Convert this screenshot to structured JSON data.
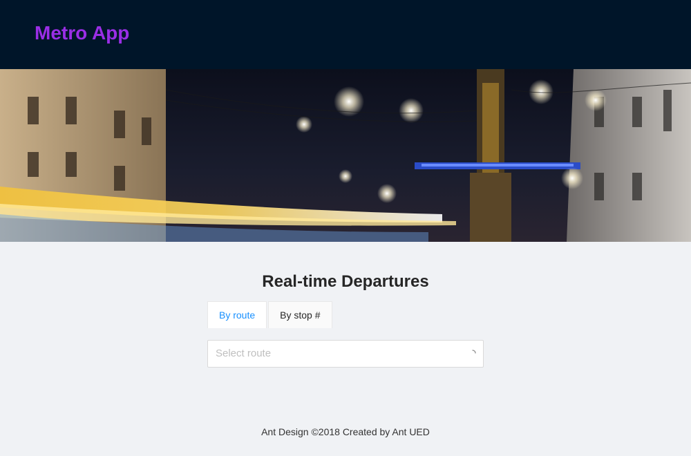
{
  "header": {
    "brand": "Metro App"
  },
  "hero": {
    "image": "night-city-street-tram-light-trails"
  },
  "main": {
    "title": "Real-time Departures",
    "tabs": [
      {
        "label": "By route",
        "active": true
      },
      {
        "label": "By stop #",
        "active": false
      }
    ],
    "select": {
      "placeholder": "Select route",
      "loading": true
    }
  },
  "footer": {
    "text": "Ant Design ©2018 Created by Ant UED"
  },
  "colors": {
    "header_bg": "#001529",
    "brand": "#9a2ee6",
    "page_bg": "#f0f2f5",
    "active_tab": "#1890ff"
  }
}
